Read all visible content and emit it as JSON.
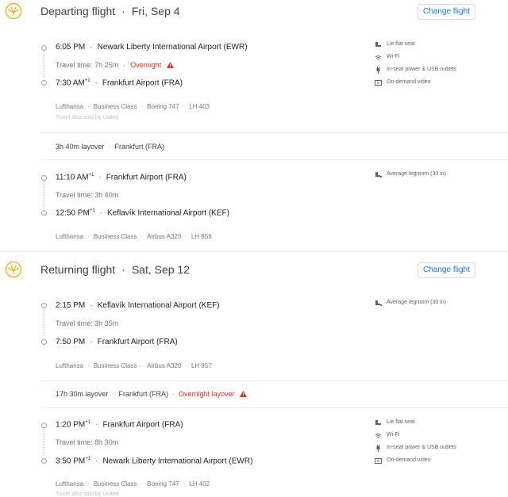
{
  "departing": {
    "title": "Departing flight",
    "date": "Fri, Sep 4",
    "change_label": "Change flight",
    "leg1": {
      "depart_time": "6:05 PM",
      "depart_airport": "Newark Liberty International Airport (EWR)",
      "travel_time": "Travel time: 7h 25m",
      "overnight": "Overnight",
      "arrive_time": "7:30 AM",
      "arrive_plus": "+1",
      "arrive_airport": "Frankfurt Airport (FRA)",
      "airline": "Lufthansa",
      "class": "Business Class",
      "aircraft": "Boeing 747",
      "flight_no": "LH 403",
      "sold_by": "Ticket also sold by United",
      "amenities": [
        "Lie flat seat",
        "Wi-Fi",
        "In-seat power & USB outlets",
        "On-demand video"
      ]
    },
    "layover": {
      "duration": "3h 40m layover",
      "city": "Frankfurt (FRA)"
    },
    "leg2": {
      "depart_time": "11:10 AM",
      "depart_plus": "+1",
      "depart_airport": "Frankfurt Airport (FRA)",
      "travel_time": "Travel time: 3h 40m",
      "arrive_time": "12:50 PM",
      "arrive_plus": "+1",
      "arrive_airport": "Keflavík International Airport (KEF)",
      "airline": "Lufthansa",
      "class": "Business Class",
      "aircraft": "Airbus A320",
      "flight_no": "LH 856",
      "amenities": [
        "Average legroom (30 in)"
      ]
    }
  },
  "returning": {
    "title": "Returning flight",
    "date": "Sat, Sep 12",
    "change_label": "Change flight",
    "leg1": {
      "depart_time": "2:15 PM",
      "depart_airport": "Keflavík International Airport (KEF)",
      "travel_time": "Travel time: 3h 35m",
      "arrive_time": "7:50 PM",
      "arrive_airport": "Frankfurt Airport (FRA)",
      "airline": "Lufthansa",
      "class": "Business Class",
      "aircraft": "Airbus A320",
      "flight_no": "LH 857",
      "amenities": [
        "Average legroom (30 in)"
      ]
    },
    "layover": {
      "duration": "17h 30m layover",
      "city": "Frankfurt (FRA)",
      "overnight": "Overnight layover"
    },
    "leg2": {
      "depart_time": "1:20 PM",
      "depart_plus": "+1",
      "depart_airport": "Frankfurt Airport (FRA)",
      "travel_time": "Travel time: 8h 30m",
      "arrive_time": "3:50 PM",
      "arrive_plus": "+1",
      "arrive_airport": "Newark Liberty International Airport (EWR)",
      "airline": "Lufthansa",
      "class": "Business Class",
      "aircraft": "Boeing 747",
      "flight_no": "LH 402",
      "sold_by": "Ticket also sold by United",
      "amenities": [
        "Lie flat seat",
        "Wi-Fi",
        "In-seat power & USB outlets",
        "On-demand video"
      ]
    }
  },
  "colors": {
    "accent": "#1a73e8",
    "warning": "#d93025",
    "logo": "#f9ab00"
  }
}
